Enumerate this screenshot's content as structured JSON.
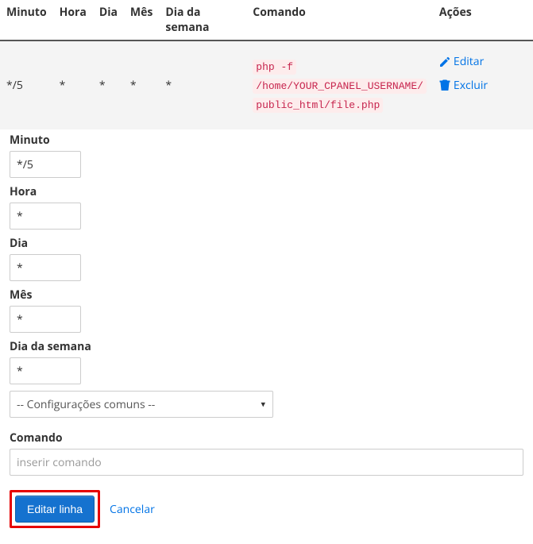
{
  "table": {
    "headers": {
      "minute": "Minuto",
      "hour": "Hora",
      "day": "Dia",
      "month": "Mês",
      "weekday": "Dia da semana",
      "command": "Comando",
      "actions": "Ações"
    },
    "row": {
      "minute": "*/5",
      "hour": "*",
      "day": "*",
      "month": "*",
      "weekday": "*",
      "command_lines": {
        "l1": "php -f",
        "l2": "/home/YOUR_CPANEL_USERNAME/",
        "l3": "public_html/file.php"
      },
      "actions": {
        "edit": "Editar",
        "delete": "Excluir"
      }
    }
  },
  "form": {
    "minute": {
      "label": "Minuto",
      "value": "*/5"
    },
    "hour": {
      "label": "Hora",
      "value": "*"
    },
    "day": {
      "label": "Dia",
      "value": "*"
    },
    "month": {
      "label": "Mês",
      "value": "*"
    },
    "weekday": {
      "label": "Dia da semana",
      "value": "*"
    },
    "common_settings": "-- Configurações comuns --",
    "command": {
      "label": "Comando",
      "placeholder": "inserir comando"
    },
    "buttons": {
      "submit": "Editar linha",
      "cancel": "Cancelar"
    }
  }
}
